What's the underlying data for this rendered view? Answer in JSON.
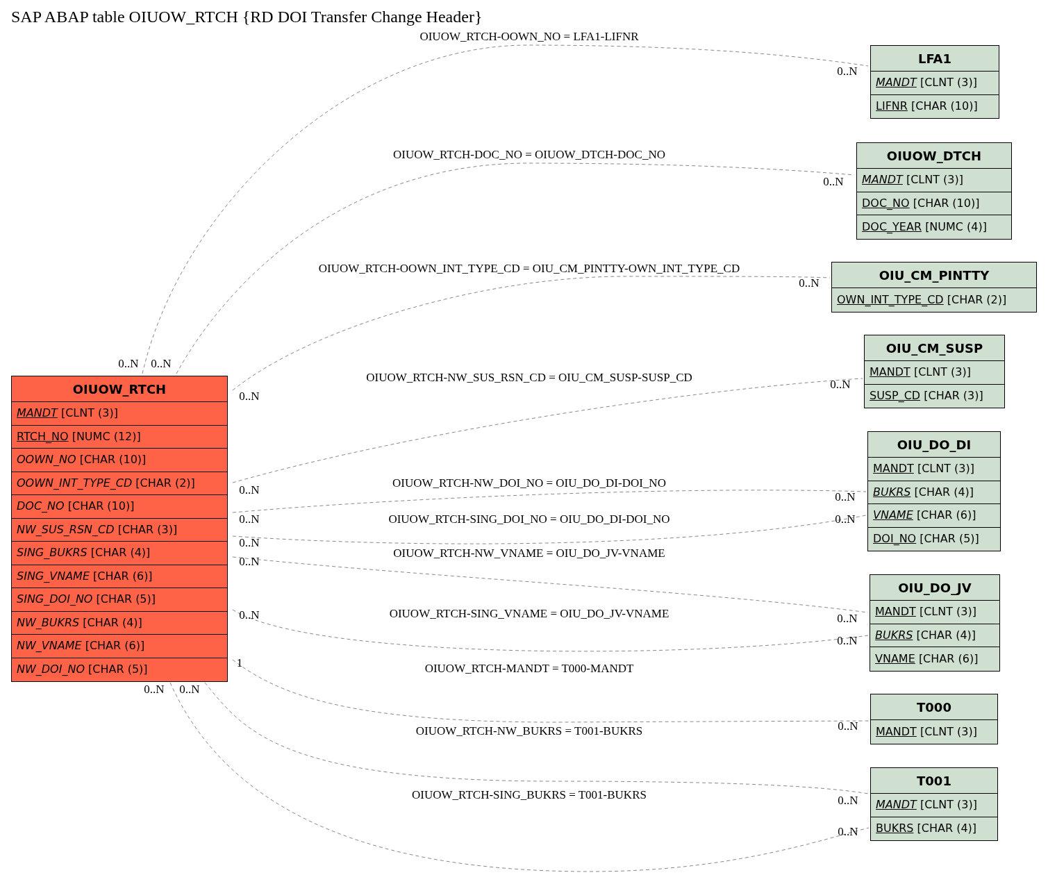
{
  "title": "SAP ABAP table OIUOW_RTCH {RD DOI Transfer Change Header}",
  "main_table": {
    "name": "OIUOW_RTCH",
    "fields": [
      {
        "name": "MANDT",
        "type": "[CLNT (3)]",
        "key": true,
        "italic": true
      },
      {
        "name": "RTCH_NO",
        "type": "[NUMC (12)]",
        "key": true,
        "italic": false
      },
      {
        "name": "OOWN_NO",
        "type": "[CHAR (10)]",
        "key": false,
        "italic": true
      },
      {
        "name": "OOWN_INT_TYPE_CD",
        "type": "[CHAR (2)]",
        "key": false,
        "italic": true
      },
      {
        "name": "DOC_NO",
        "type": "[CHAR (10)]",
        "key": false,
        "italic": true
      },
      {
        "name": "NW_SUS_RSN_CD",
        "type": "[CHAR (3)]",
        "key": false,
        "italic": true
      },
      {
        "name": "SING_BUKRS",
        "type": "[CHAR (4)]",
        "key": false,
        "italic": true
      },
      {
        "name": "SING_VNAME",
        "type": "[CHAR (6)]",
        "key": false,
        "italic": true
      },
      {
        "name": "SING_DOI_NO",
        "type": "[CHAR (5)]",
        "key": false,
        "italic": true
      },
      {
        "name": "NW_BUKRS",
        "type": "[CHAR (4)]",
        "key": false,
        "italic": true
      },
      {
        "name": "NW_VNAME",
        "type": "[CHAR (6)]",
        "key": false,
        "italic": true
      },
      {
        "name": "NW_DOI_NO",
        "type": "[CHAR (5)]",
        "key": false,
        "italic": true
      }
    ]
  },
  "related_tables": [
    {
      "name": "LFA1",
      "fields": [
        {
          "name": "MANDT",
          "type": "[CLNT (3)]",
          "key": true,
          "italic": true
        },
        {
          "name": "LIFNR",
          "type": "[CHAR (10)]",
          "key": true,
          "italic": false
        }
      ]
    },
    {
      "name": "OIUOW_DTCH",
      "fields": [
        {
          "name": "MANDT",
          "type": "[CLNT (3)]",
          "key": true,
          "italic": true
        },
        {
          "name": "DOC_NO",
          "type": "[CHAR (10)]",
          "key": true,
          "italic": false
        },
        {
          "name": "DOC_YEAR",
          "type": "[NUMC (4)]",
          "key": true,
          "italic": false
        }
      ]
    },
    {
      "name": "OIU_CM_PINTTY",
      "fields": [
        {
          "name": "OWN_INT_TYPE_CD",
          "type": "[CHAR (2)]",
          "key": true,
          "italic": false
        }
      ]
    },
    {
      "name": "OIU_CM_SUSP",
      "fields": [
        {
          "name": "MANDT",
          "type": "[CLNT (3)]",
          "key": true,
          "italic": false
        },
        {
          "name": "SUSP_CD",
          "type": "[CHAR (3)]",
          "key": true,
          "italic": false
        }
      ]
    },
    {
      "name": "OIU_DO_DI",
      "fields": [
        {
          "name": "MANDT",
          "type": "[CLNT (3)]",
          "key": true,
          "italic": false
        },
        {
          "name": "BUKRS",
          "type": "[CHAR (4)]",
          "key": true,
          "italic": true
        },
        {
          "name": "VNAME",
          "type": "[CHAR (6)]",
          "key": true,
          "italic": true
        },
        {
          "name": "DOI_NO",
          "type": "[CHAR (5)]",
          "key": true,
          "italic": false
        }
      ]
    },
    {
      "name": "OIU_DO_JV",
      "fields": [
        {
          "name": "MANDT",
          "type": "[CLNT (3)]",
          "key": true,
          "italic": false
        },
        {
          "name": "BUKRS",
          "type": "[CHAR (4)]",
          "key": true,
          "italic": true
        },
        {
          "name": "VNAME",
          "type": "[CHAR (6)]",
          "key": true,
          "italic": false
        }
      ]
    },
    {
      "name": "T000",
      "fields": [
        {
          "name": "MANDT",
          "type": "[CLNT (3)]",
          "key": true,
          "italic": false
        }
      ]
    },
    {
      "name": "T001",
      "fields": [
        {
          "name": "MANDT",
          "type": "[CLNT (3)]",
          "key": true,
          "italic": true
        },
        {
          "name": "BUKRS",
          "type": "[CHAR (4)]",
          "key": true,
          "italic": false
        }
      ]
    }
  ],
  "relations": [
    {
      "label": "OIUOW_RTCH-OOWN_NO = LFA1-LIFNR",
      "source_cardinality": "0..N",
      "target_cardinality": "0..N"
    },
    {
      "label": "OIUOW_RTCH-DOC_NO = OIUOW_DTCH-DOC_NO",
      "source_cardinality": "0..N",
      "target_cardinality": "0..N"
    },
    {
      "label": "OIUOW_RTCH-OOWN_INT_TYPE_CD = OIU_CM_PINTTY-OWN_INT_TYPE_CD",
      "source_cardinality": "0..N",
      "target_cardinality": "0..N"
    },
    {
      "label": "OIUOW_RTCH-NW_SUS_RSN_CD = OIU_CM_SUSP-SUSP_CD",
      "source_cardinality": "0..N",
      "target_cardinality": "0..N"
    },
    {
      "label": "OIUOW_RTCH-NW_DOI_NO = OIU_DO_DI-DOI_NO",
      "source_cardinality": "0..N",
      "target_cardinality": "0..N"
    },
    {
      "label": "OIUOW_RTCH-SING_DOI_NO = OIU_DO_DI-DOI_NO",
      "source_cardinality": "0..N",
      "target_cardinality": "0..N"
    },
    {
      "label": "OIUOW_RTCH-NW_VNAME = OIU_DO_JV-VNAME",
      "source_cardinality": "0..N",
      "target_cardinality": "0..N"
    },
    {
      "label": "OIUOW_RTCH-SING_VNAME = OIU_DO_JV-VNAME",
      "source_cardinality": "0..N",
      "target_cardinality": "0..N"
    },
    {
      "label": "OIUOW_RTCH-MANDT = T000-MANDT",
      "source_cardinality": "1",
      "target_cardinality": "0..N"
    },
    {
      "label": "OIUOW_RTCH-NW_BUKRS = T001-BUKRS",
      "source_cardinality": "0..N",
      "target_cardinality": "0..N"
    },
    {
      "label": "OIUOW_RTCH-SING_BUKRS = T001-BUKRS",
      "source_cardinality": "0..N",
      "target_cardinality": "0..N"
    }
  ]
}
